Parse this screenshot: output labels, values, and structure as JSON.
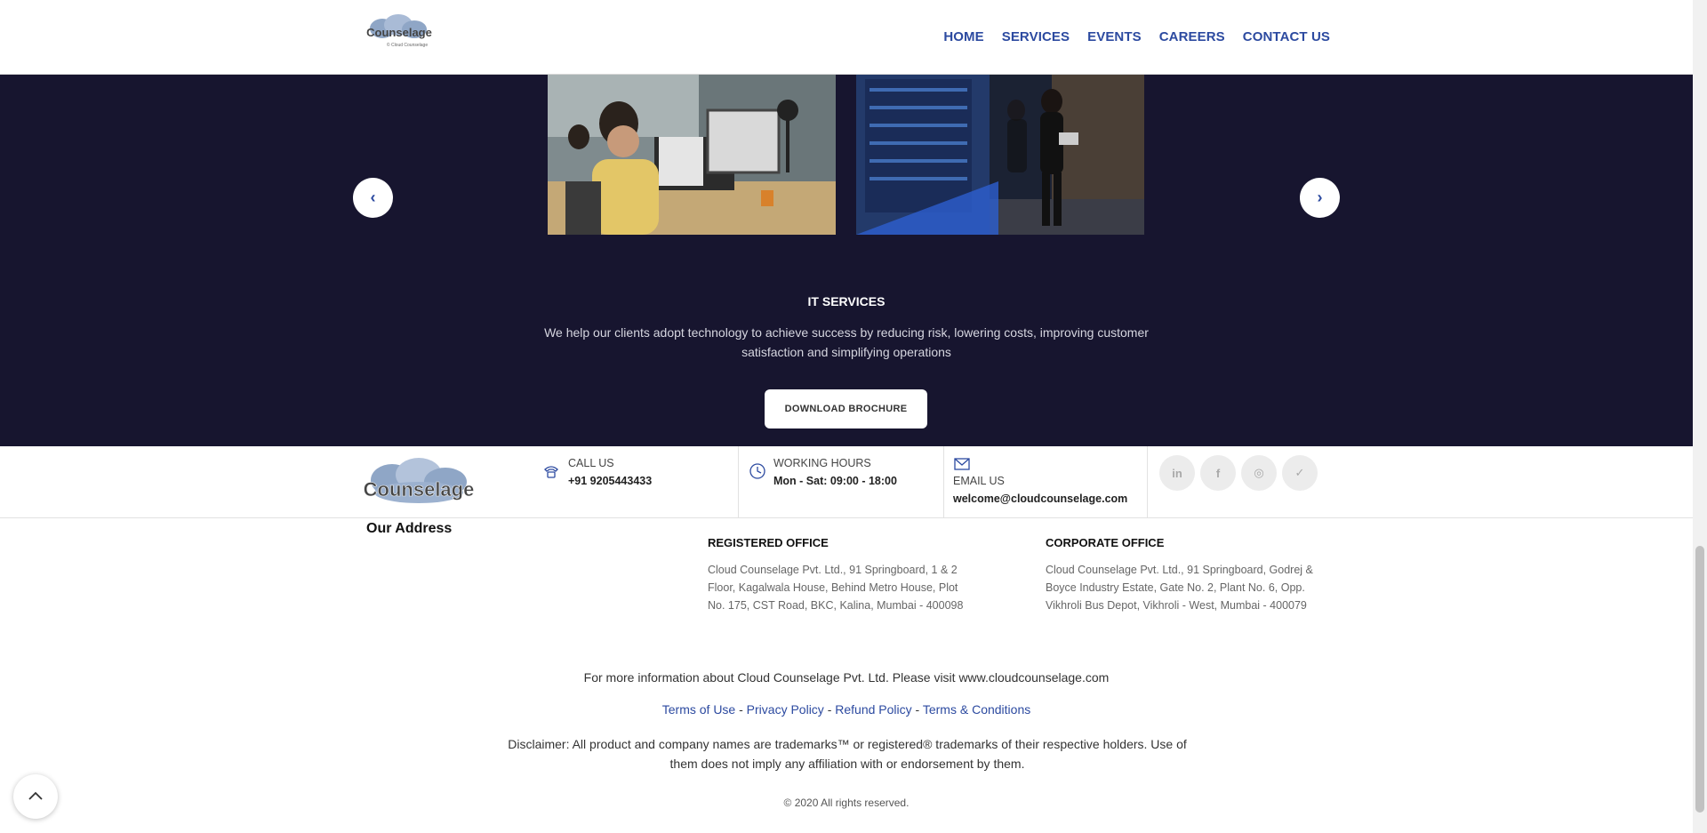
{
  "header": {
    "logo_alt": "Counselage",
    "nav": [
      "HOME",
      "SERVICES",
      "EVENTS",
      "CAREERS",
      "CONTACT US"
    ]
  },
  "hero": {
    "title": "IT SERVICES",
    "description": "We help our clients adopt technology to achieve success by reducing risk, lowering costs, improving customer satisfaction and simplifying operations",
    "button": "DOWNLOAD BROCHURE",
    "prev_icon": "chevron-left-icon",
    "next_icon": "chevron-right-icon"
  },
  "contact": {
    "call": {
      "label": "CALL US",
      "value": "+91 9205443433",
      "icon": "phone-icon"
    },
    "hours": {
      "label": "WORKING HOURS",
      "value": "Mon - Sat: 09:00 - 18:00",
      "icon": "clock-icon"
    },
    "email": {
      "label": "EMAIL US",
      "value": "welcome@cloudcounselage.com",
      "icon": "mail-icon"
    },
    "social": [
      {
        "name": "linkedin-icon",
        "glyph": "in"
      },
      {
        "name": "facebook-icon",
        "glyph": "f"
      },
      {
        "name": "instagram-icon",
        "glyph": "◎"
      },
      {
        "name": "twitter-icon",
        "glyph": "✓"
      }
    ]
  },
  "address": {
    "heading": "Our Address",
    "registered": {
      "title": "REGISTERED OFFICE",
      "text": "Cloud Counselage Pvt. Ltd., 91 Springboard, 1 & 2 Floor, Kagalwala House, Behind Metro House, Plot No. 175, CST Road, BKC, Kalina, Mumbai - 400098"
    },
    "corporate": {
      "title": "CORPORATE OFFICE",
      "text": "Cloud Counselage Pvt. Ltd., 91 Springboard, Godrej & Boyce Industry Estate, Gate No. 2, Plant No. 6, Opp. Vikhroli Bus Depot, Vikhroli - West, Mumbai - 400079"
    }
  },
  "footer": {
    "more_info": "For more information about Cloud Counselage Pvt. Ltd. Please visit www.cloudcounselage.com",
    "links": [
      "Terms of Use",
      "Privacy Policy",
      "Refund Policy",
      "Terms & Conditions"
    ],
    "separator": " - ",
    "disclaimer": "Disclaimer: All product and company names are trademarks™ or registered® trademarks of their respective holders. Use of them does not imply any affiliation with or endorsement by them.",
    "copyright": "© 2020 All rights reserved."
  },
  "colors": {
    "accent": "#2c4aa0",
    "hero_bg": "#17152f"
  }
}
